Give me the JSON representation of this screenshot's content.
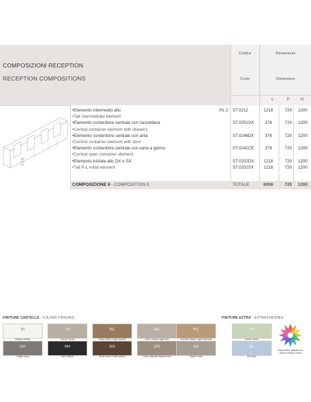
{
  "header": {
    "title_it": "COMPOSIZIONI RECEPTION",
    "title_en": "RECEPTION COMPOSITIONS",
    "codice_label": "Codice",
    "code_label": "Code",
    "dimensioni_label": "Dimensioni",
    "dimension_label": "Dimension",
    "L": "L",
    "P": "P",
    "H": "H"
  },
  "rows": [
    {
      "desc": "•Elemento intermedio alto",
      "pz": "Pz.2",
      "code": "ST.0212",
      "l": "1218",
      "p": "720",
      "h": "1200",
      "en": false
    },
    {
      "desc": "•Tall intermediate element",
      "pz": "",
      "code": "",
      "l": "",
      "p": "",
      "h": "",
      "en": true
    },
    {
      "desc": "•Elemento contenitore centrale con cassettiera",
      "pz": "",
      "code": "ST.0251SX",
      "l": "378",
      "p": "720",
      "h": "1200",
      "en": false
    },
    {
      "desc": "•Central container element with drawers",
      "pz": "",
      "code": "",
      "l": "",
      "p": "",
      "h": "",
      "en": true
    },
    {
      "desc": "•Elemento contenitore centrale con anta",
      "pz": "",
      "code": "ST.0246DX",
      "l": "378",
      "p": "720",
      "h": "1200",
      "en": false
    },
    {
      "desc": "•Central container element with door",
      "pz": "",
      "code": "",
      "l": "",
      "p": "",
      "h": "",
      "en": true
    },
    {
      "desc": "•Elemento contenitore centrale con vano a giorno",
      "pz": "",
      "code": "ST.0241CE",
      "l": "378",
      "p": "720",
      "h": "1200",
      "en": false
    },
    {
      "desc": "•Central open container element",
      "pz": "",
      "code": "",
      "l": "",
      "p": "",
      "h": "",
      "en": true
    },
    {
      "desc": "•Elemento iniziale alto DX e SX",
      "pz": "",
      "code": "ST.0202DX",
      "l": "1218",
      "p": "720",
      "h": "1200",
      "en": false
    },
    {
      "desc": "•Tall R-L initial element",
      "pz": "",
      "code": "ST.0202SX",
      "l": "1218",
      "p": "720",
      "h": "1200",
      "en": true
    }
  ],
  "total": {
    "label_it": "COMPOSIZIONE 6",
    "label_sep": " - ",
    "label_en": "COMPOSITION 6",
    "total_label": "TOTALE",
    "l": "6006",
    "p": "720",
    "h": "1200"
  },
  "finishes": {
    "folder_title": "FINITURE CARTELLA",
    "folder_title_en": " - FOLDER FINISHES",
    "extra_title": "FINITURE EXTRA",
    "extra_title_en": " - EXTRA FINISHES",
    "folder": [
      {
        "code": "BI",
        "label": "Bianco White",
        "color": "#f3f5ee",
        "dark": true
      },
      {
        "code": "TR",
        "label": "Tortora Taupe",
        "color": "#b8aea2",
        "dark": false
      },
      {
        "code": "NC",
        "label": "Noce chiaro Light walnut",
        "color": "#9a7a5e",
        "dark": false
      },
      {
        "code": "OC",
        "label": "Olmo chiaro Light elm",
        "color": "#b9afa4",
        "dark": false
      },
      {
        "code": "RC",
        "label": "Rovere chiaro Light durmast",
        "color": "#b89a78",
        "dark": false
      },
      {
        "code": "GR",
        "label": "Grigio Grey",
        "color": "#7d7a78",
        "dark": false
      },
      {
        "code": "NR",
        "label": "Nero Black",
        "color": "#2b2a2a",
        "dark": false
      },
      {
        "code": "NS",
        "label": "Noce scuro Dark walnut",
        "color": "#5a4436",
        "dark": false
      },
      {
        "code": "ON",
        "label": "Olmo naturale Natural elm",
        "color": "#9c8f80",
        "dark": false
      },
      {
        "code": "SA",
        "label": "Salice Sallo",
        "color": "#a89d91",
        "dark": false
      }
    ],
    "extra": [
      {
        "code": "VR",
        "label": "Verde Green",
        "color": "#c9d5b8",
        "dark": false
      },
      {
        "code": "BL",
        "label": "Blu Blue",
        "color": "#b9c9dc",
        "dark": false
      }
    ],
    "extra_note_1": "Disponibile cartella con",
    "extra_note_2": "ulteriori finiture extra"
  }
}
